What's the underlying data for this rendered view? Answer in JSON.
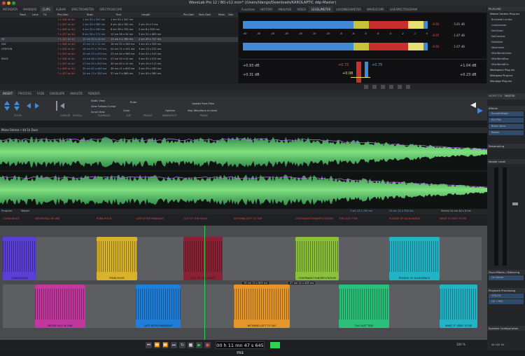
{
  "window": {
    "title": "WaveLab Pro 12 / BO.v12.mon* (/Users/ldango/Downloads/KAROLAPTIC ddp-Master)"
  },
  "top_tabs": [
    "METADATA",
    "MARKERS",
    "CLIPS",
    "ALBUM",
    "SPECTROMETER",
    "SPECTROSCOPE"
  ],
  "clips_table": {
    "columns": [
      "Track",
      "Lane",
      "FX",
      "Pre-Gain",
      "Start",
      "End",
      "Length",
      "Pre-Gain",
      "Post-Gain",
      "Mute",
      "Gen"
    ],
    "rows": [
      {
        "name": "",
        "start": "1 sm 52 s 347 ms",
        "end": "1 sm 52 s 347 ms",
        "length": "",
        "pre": "7 x 426 ex 4d",
        "sel": false
      },
      {
        "name": "",
        "start": "1 sm 52 s 589 ms",
        "end": "4 sm 18 s 762 ms",
        "length": "2 sm 19 s 5 ms",
        "pre": "7 x 427 ex 4d",
        "sel": false
      },
      {
        "name": "",
        "start": "4 sm 20 s 180 ms",
        "end": "6 sm 28 s 700 ms",
        "length": "2 sm 8 s 520 ms",
        "pre": "7 x 426 ex 4d",
        "sel": false
      },
      {
        "name": "",
        "start": "6 sm 56 s 171 ms",
        "end": "10 sm 28 s 54 ms",
        "length": "3 sm 31 s 883 ms",
        "pre": "7 x 427 ex 4d",
        "sel": false
      },
      {
        "name": "HT",
        "start": "10 sm 30 s 13 ms",
        "end": "13 sm 9 s 760 ms",
        "length": "2 sm 39 s 747 ms",
        "pre": "7 x 427 ex 4d",
        "sel": true
      },
      {
        "name": "SAY",
        "start": "13 sm 11 s 11 ms",
        "end": "16 sm 52 s 340 ms",
        "length": "3 sm 41 s 329 ms",
        "pre": "7 x 426 ex 4d",
        "sel": false
      },
      {
        "name": "UTATION",
        "start": "16 sm 57 s 790 ms",
        "end": "20 sm 11 s 101 ms",
        "length": "3 sm 13 s 311 ms",
        "pre": "7 x 426 ex 4d",
        "sel": false
      },
      {
        "name": "",
        "start": "20 sm 13 s 470 ms",
        "end": "23 sm 44 s 980 ms",
        "length": "3 sm 31 s 510 ms",
        "pre": "7 x 427 ex 4d",
        "sel": false
      },
      {
        "name": "ENCE",
        "start": "23 sm 46 s 530 ms",
        "end": "27 sm 19 s 41 ms",
        "length": "3 sm 32 s 511 ms",
        "pre": "7 x 426 ex 4d",
        "sel": false
      },
      {
        "name": "",
        "start": "27 sm 20 s 900 ms",
        "end": "30 sm 40 s 12 ms",
        "length": "3 sm 19 s 112 ms",
        "pre": "7 x 427 ex 4d",
        "sel": false
      },
      {
        "name": "",
        "start": "30 sm 42 s 440 ms",
        "end": "34 sm 11 s 620 ms",
        "length": "3 sm 29 s 180 ms",
        "pre": "7 x 426 ex 4d",
        "sel": false
      },
      {
        "name": "",
        "start": "34 sm 13 s 300 ms",
        "end": "37 sm 2 s 880 ms",
        "length": "2 sm 49 s 580 ms",
        "pre": "7 x 427 ex 4d",
        "sel": false
      }
    ]
  },
  "meter_tabs": [
    "Functions",
    "HISTORY",
    "ANALYSIS",
    "VIDEO",
    "LEVEL/METER",
    "LOUDNESSMETER",
    "WAVESCOPE",
    "LIVESPECTROGRAM"
  ],
  "meters": {
    "row_values": [
      "-0.91",
      "-5.81 dB",
      "-0.91",
      "-1.67 dB"
    ],
    "right_values": [
      "-0.97",
      "-1.87 dB"
    ],
    "peak_left": "+0.93 dB",
    "peak_left2": "+0.31 dB",
    "mid_val1": "+0.72",
    "mid_val2": "+0.08",
    "mid_blue": "+0.75",
    "right_top": "+1.04 dB",
    "right_bot": "+0.23 dB",
    "scale": [
      "-40",
      "-30",
      "-24",
      "-20",
      "-16",
      "-12",
      "-10",
      "-8",
      "-6",
      "-5",
      "-4",
      "-3",
      "-2",
      "-1",
      "0"
    ]
  },
  "right_panel": {
    "header": "PLUG-INS",
    "items": [
      "Master Section Plug-ins",
      "Brickwall Limiter",
      "Compressor",
      "DeClicker",
      "DeCrackler",
      "DeNoiser",
      "Maximizer",
      "MultiBandComp",
      "MultiBandExp",
      "MultiBandEnv",
      "Workspace Plug-ins",
      "Multipass Plug-ins",
      "Montage Plug-ins"
    ],
    "tabs": [
      "INSPECTOR",
      "MASTER"
    ],
    "effects_title": "Effects",
    "effects": [
      "SonalksMagic",
      "EQ-P3A",
      "Black Valve",
      "Roben"
    ],
    "resampling": "Resampling",
    "master_level": "Master Level",
    "final_title": "Final Effects / Dithering",
    "final_items": [
      "Lin Dither"
    ],
    "playback_title": "Playback Processing",
    "playback_items": [
      "CFQ-15",
      "LN → M/S"
    ],
    "speaker_title": "Speaker Configuration",
    "bottom": "44.100 Hz"
  },
  "edit_tabs": [
    "INSERT",
    "PROCESS",
    "FADE",
    "ENVELOPE",
    "ANALYZE",
    "RENDER"
  ],
  "ribbon": {
    "groups": [
      "ZOOM",
      "CURSOR",
      "SCROLL",
      "PLAYBACK",
      "CLIP",
      "TRACKS",
      "SNAPSHOTS",
      "PEAKS"
    ],
    "buttons": [
      "Static View",
      "View Follows Cursor",
      "Scroll View",
      "Ruler",
      "Color",
      "Options",
      "Update Peak Files",
      "Map Waveform to Level"
    ]
  },
  "wave": {
    "title": "Mono Stereo • 44.1k Dual",
    "foot_left": "Program",
    "foot_right": "Master",
    "time1": "1 sm 13 s 700 ms",
    "time2": "23 sm 12 s 200 ms",
    "time3": "Stereo 14 sm 44 s 0 ms"
  },
  "montage": {
    "markers": [
      "CONSCIENCE",
      "NEVER FALL IN LINE",
      "PUNK ROCK",
      "LATE AFTER MIDNIGHT",
      "OUT OF THE NIGHT",
      "NOTHING LEFT TO SAY",
      "CONTRADICTION/REFUTATION",
      "THE LAST TIDE",
      "PLEDGE OF ALLEGIANCE",
      "WHAT IT USED TO BE"
    ],
    "clips": [
      {
        "label": "CONSCIENCE",
        "color": "#5a3fd6"
      },
      {
        "label": "NEVER FALL IN LINE",
        "color": "#c0389e"
      },
      {
        "label": "PUNK ROCK",
        "color": "#d8b22a"
      },
      {
        "label": "LATE AFTER MIDNIGHT",
        "color": "#1f7ed8"
      },
      {
        "label": "OUT OF THE NIGHT",
        "color": "#8a2236"
      },
      {
        "label": "NOTHING LEFT TO SAY",
        "color": "#e4962a"
      },
      {
        "label": "CONTRADICTION/REFUTATION",
        "color": "#8ac03a"
      },
      {
        "label": "THE LAST TIDE",
        "color": "#2bc07a"
      },
      {
        "label": "PLEDGE OF ALLEGIANCE",
        "color": "#22b4c4"
      },
      {
        "label": "WHAT IT USED TO BE",
        "color": "#22b4c4"
      }
    ],
    "status_left": "19 sm 13 s 855 ms",
    "status_right": "27 sm 12 s 435 ms",
    "zoom": "100 %"
  },
  "transport": {
    "time": "00 h 11 mn 47 s 645 ms"
  }
}
